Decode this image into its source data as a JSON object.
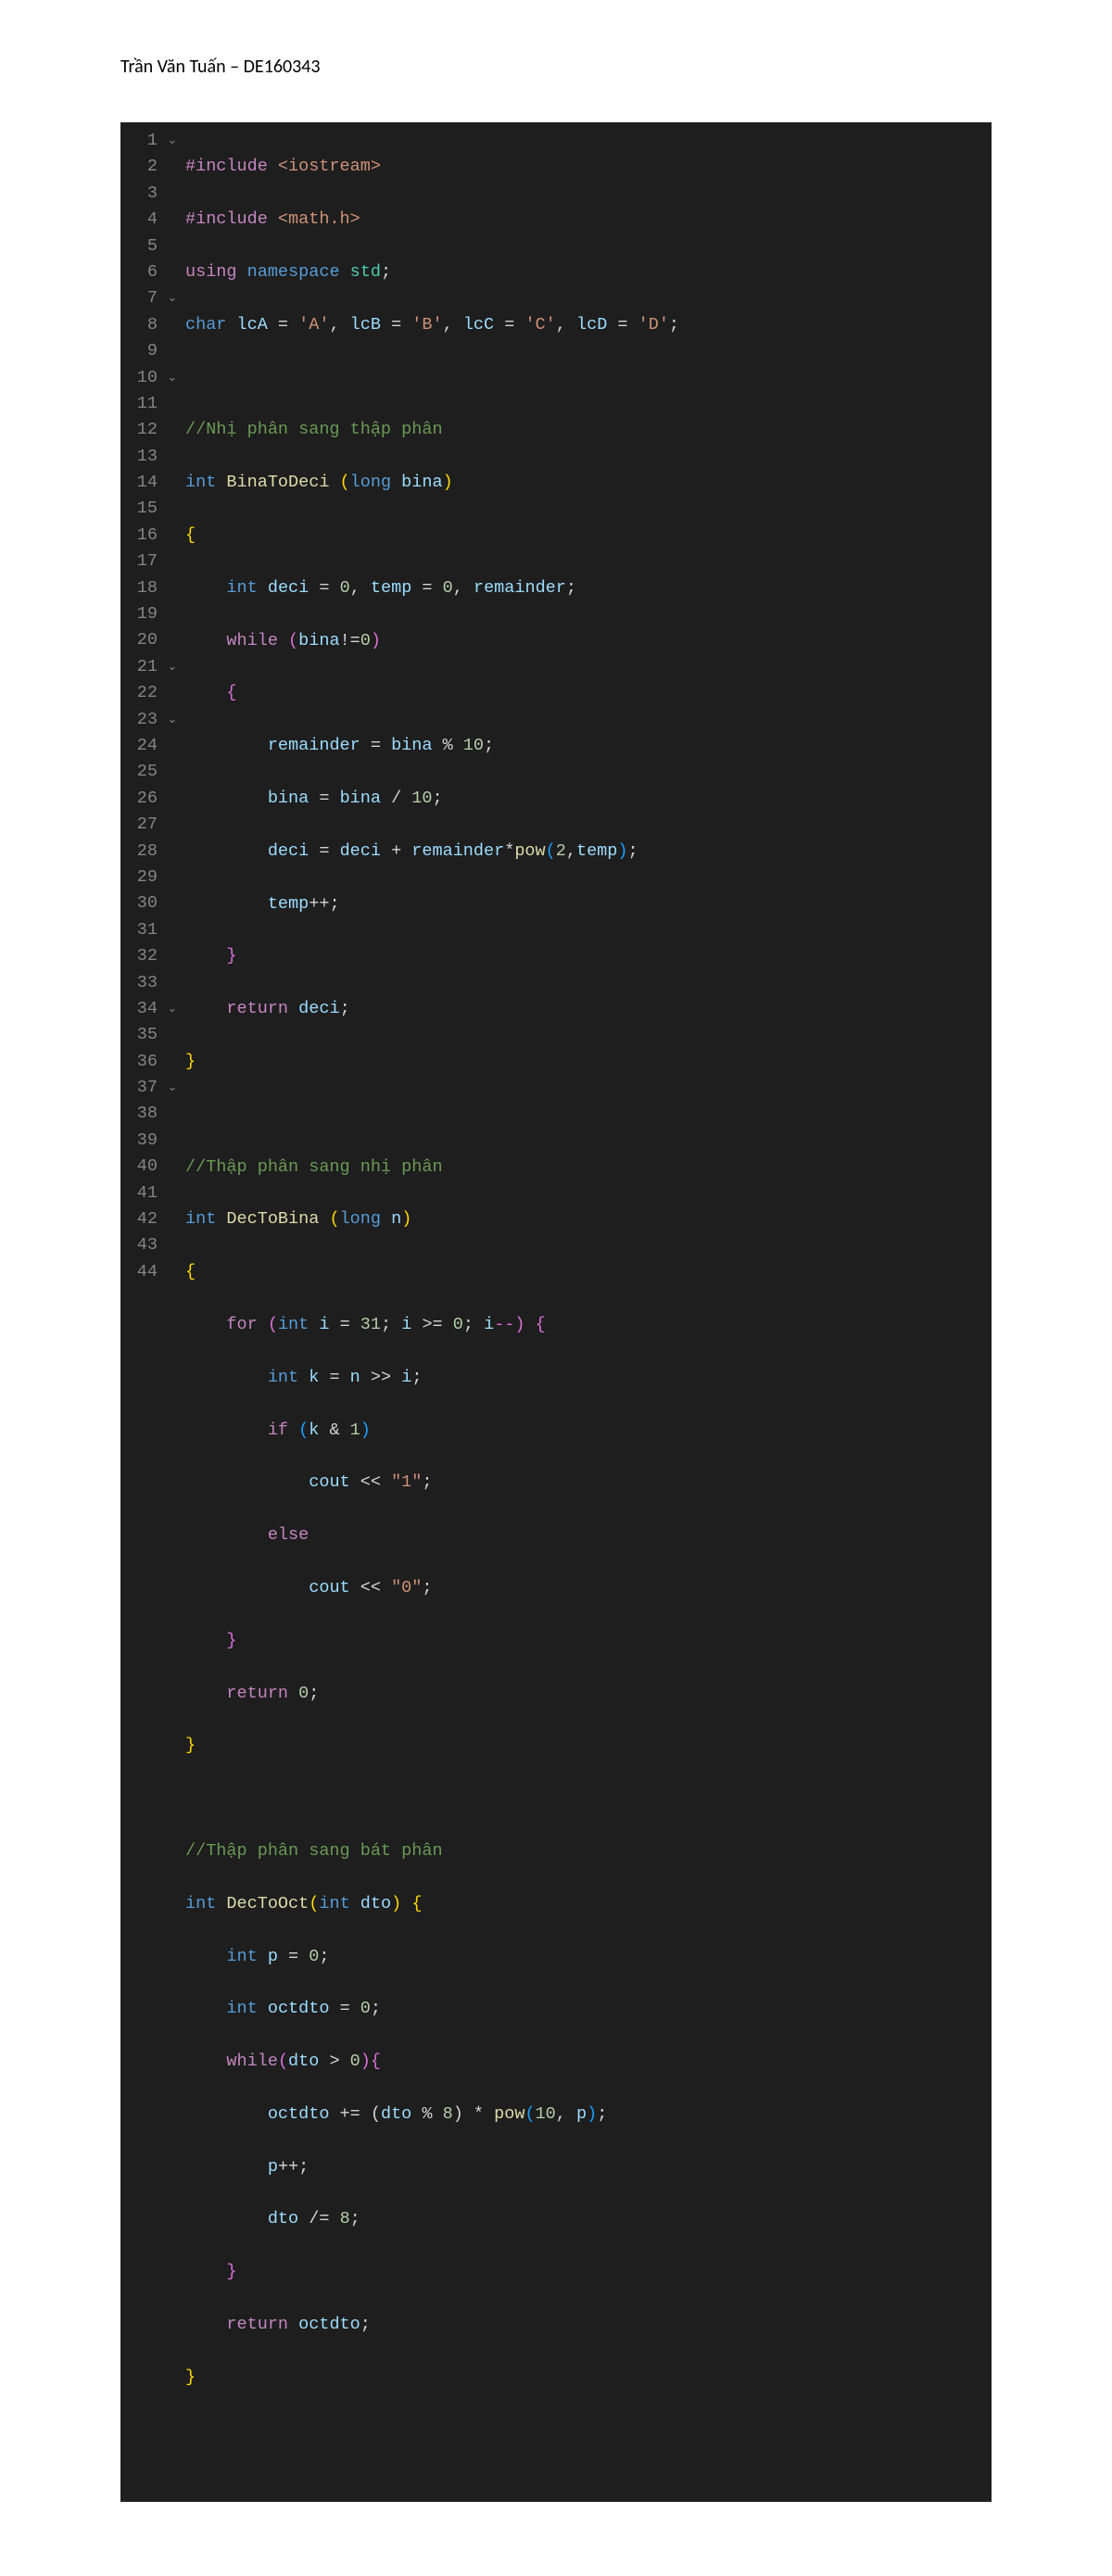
{
  "header": "Trần Văn Tuấn – DE160343",
  "lines": {
    "n1": "1",
    "n2": "2",
    "n3": "3",
    "n4": "4",
    "n5": "5",
    "n6": "6",
    "n7": "7",
    "n8": "8",
    "n9": "9",
    "n10": "10",
    "n11": "11",
    "n12": "12",
    "n13": "13",
    "n14": "14",
    "n15": "15",
    "n16": "16",
    "n17": "17",
    "n18": "18",
    "n19": "19",
    "n20": "20",
    "n21": "21",
    "n22": "22",
    "n23": "23",
    "n24": "24",
    "n25": "25",
    "n26": "26",
    "n27": "27",
    "n28": "28",
    "n29": "29",
    "n30": "30",
    "n31": "31",
    "n32": "32",
    "n33": "33",
    "n34": "34",
    "n35": "35",
    "n36": "36",
    "n37": "37",
    "n38": "38",
    "n39": "39",
    "n40": "40",
    "n41": "41",
    "n42": "42",
    "n43": "43",
    "n44": "44"
  },
  "fold": {
    "f1": "⌄",
    "f7": "⌄",
    "f10": "⌄",
    "f21": "⌄",
    "f23": "⌄",
    "f34": "⌄",
    "f37": "⌄"
  },
  "code": {
    "l1": {
      "a": "#include ",
      "b": "<iostream>"
    },
    "l2": {
      "a": "#include ",
      "b": "<math.h>"
    },
    "l3": {
      "a": "using ",
      "b": "namespace ",
      "c": "std",
      "d": ";"
    },
    "l4": {
      "a": "char ",
      "b": "lcA",
      "c": " = ",
      "d": "'A'",
      "e": ", ",
      "f": "lcB",
      "g": " = ",
      "h": "'B'",
      "i": ", ",
      "j": "lcC",
      "k": " = ",
      "l": "'C'",
      "m": ", ",
      "n": "lcD",
      "o": " = ",
      "p": "'D'",
      "q": ";"
    },
    "l6": {
      "a": "//Nhị phân sang thập phân"
    },
    "l7": {
      "a": "int ",
      "b": "BinaToDeci ",
      "c": "(",
      "d": "long ",
      "e": "bina",
      "f": ")"
    },
    "l8": {
      "a": "{"
    },
    "l9": {
      "a": "    ",
      "b": "int ",
      "c": "deci",
      "d": " = ",
      "e": "0",
      "f": ", ",
      "g": "temp",
      "h": " = ",
      "i": "0",
      "j": ", ",
      "k": "remainder",
      "l": ";"
    },
    "l10": {
      "a": "    ",
      "b": "while ",
      "c": "(",
      "d": "bina",
      "e": "!=",
      "f": "0",
      "g": ")"
    },
    "l11": {
      "a": "    ",
      "b": "{"
    },
    "l12": {
      "a": "        ",
      "b": "remainder",
      "c": " = ",
      "d": "bina",
      "e": " % ",
      "f": "10",
      "g": ";"
    },
    "l13": {
      "a": "        ",
      "b": "bina",
      "c": " = ",
      "d": "bina",
      "e": " / ",
      "f": "10",
      "g": ";"
    },
    "l14": {
      "a": "        ",
      "b": "deci",
      "c": " = ",
      "d": "deci",
      "e": " + ",
      "f": "remainder",
      "g": "*",
      "h": "pow",
      "i": "(",
      "j": "2",
      "k": ",",
      "l": "temp",
      "m": ")",
      "n": ";"
    },
    "l15": {
      "a": "        ",
      "b": "temp",
      "c": "++;"
    },
    "l16": {
      "a": "    ",
      "b": "}"
    },
    "l17": {
      "a": "    ",
      "b": "return ",
      "c": "deci",
      "d": ";"
    },
    "l18": {
      "a": "}"
    },
    "l20": {
      "a": "//Thập phân sang nhị phân"
    },
    "l21": {
      "a": "int ",
      "b": "DecToBina ",
      "c": "(",
      "d": "long ",
      "e": "n",
      "f": ")"
    },
    "l22": {
      "a": "{"
    },
    "l23": {
      "a": "    ",
      "b": "for ",
      "c": "(",
      "d": "int ",
      "e": "i",
      "f": " = ",
      "g": "31",
      "h": "; ",
      "i": "i",
      "j": " >= ",
      "k": "0",
      "l": "; ",
      "m": "i",
      "n": "--) ",
      "o": "{"
    },
    "l24": {
      "a": "        ",
      "b": "int ",
      "c": "k",
      "d": " = ",
      "e": "n",
      "f": " >> ",
      "g": "i",
      "h": ";"
    },
    "l25": {
      "a": "        ",
      "b": "if ",
      "c": "(",
      "d": "k",
      "e": " & ",
      "f": "1",
      "g": ")"
    },
    "l26": {
      "a": "            ",
      "b": "cout",
      "c": " << ",
      "d": "\"1\"",
      "e": ";"
    },
    "l27": {
      "a": "        ",
      "b": "else"
    },
    "l28": {
      "a": "            ",
      "b": "cout",
      "c": " << ",
      "d": "\"0\"",
      "e": ";"
    },
    "l29": {
      "a": "    ",
      "b": "}"
    },
    "l30": {
      "a": "    ",
      "b": "return ",
      "c": "0",
      "d": ";"
    },
    "l31": {
      "a": "}"
    },
    "l33": {
      "a": "//Thập phân sang bát phân"
    },
    "l34": {
      "a": "int ",
      "b": "DecToOct",
      "c": "(",
      "d": "int ",
      "e": "dto",
      "f": ")",
      " ": " ",
      "g": "{"
    },
    "l35": {
      "a": "    ",
      "b": "int ",
      "c": "p",
      "d": " = ",
      "e": "0",
      "f": ";"
    },
    "l36": {
      "a": "    ",
      "b": "int ",
      "c": "octdto",
      "d": " = ",
      "e": "0",
      "f": ";"
    },
    "l37": {
      "a": "    ",
      "b": "while",
      "c": "(",
      "d": "dto",
      "e": " > ",
      "f": "0",
      "g": ")",
      "h": "{"
    },
    "l38": {
      "a": "        ",
      "b": "octdto",
      "c": " += (",
      "d": "dto",
      "e": " % ",
      "f": "8",
      "g": ") * ",
      "h": "pow",
      "i": "(",
      "j": "10",
      "k": ", ",
      "l": "p",
      "m": ")",
      "n": ";"
    },
    "l39": {
      "a": "        ",
      "b": "p",
      "c": "++;"
    },
    "l40": {
      "a": "        ",
      "b": "dto",
      "c": " /= ",
      "d": "8",
      "e": ";"
    },
    "l41": {
      "a": "    ",
      "b": "}"
    },
    "l42": {
      "a": "    ",
      "b": "return ",
      "c": "octdto",
      "d": ";"
    },
    "l43": {
      "a": "}"
    }
  }
}
